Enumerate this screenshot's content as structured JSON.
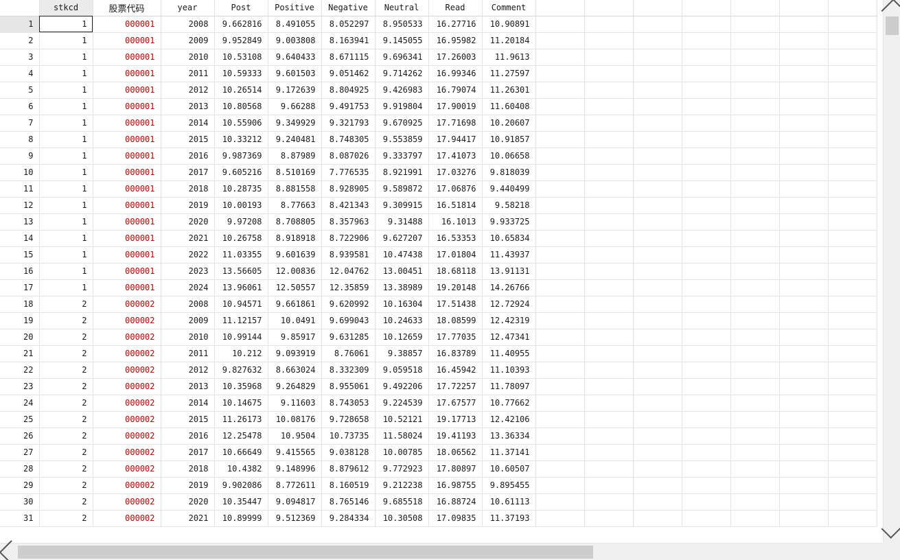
{
  "columns": [
    "stkcd",
    "股票代码",
    "year",
    "Post",
    "Positive",
    "Negative",
    "Neutral",
    "Read",
    "Comment"
  ],
  "rows": [
    [
      "1",
      "1",
      "000001",
      "2008",
      "9.662816",
      "8.491055",
      "8.052297",
      "8.950533",
      "16.27716",
      "10.90891"
    ],
    [
      "2",
      "1",
      "000001",
      "2009",
      "9.952849",
      "9.003808",
      "8.163941",
      "9.145055",
      "16.95982",
      "11.20184"
    ],
    [
      "3",
      "1",
      "000001",
      "2010",
      "10.53108",
      "9.640433",
      "8.671115",
      "9.696341",
      "17.26003",
      "11.9613"
    ],
    [
      "4",
      "1",
      "000001",
      "2011",
      "10.59333",
      "9.601503",
      "9.051462",
      "9.714262",
      "16.99346",
      "11.27597"
    ],
    [
      "5",
      "1",
      "000001",
      "2012",
      "10.26514",
      "9.172639",
      "8.804925",
      "9.426983",
      "16.79074",
      "11.26301"
    ],
    [
      "6",
      "1",
      "000001",
      "2013",
      "10.80568",
      "9.66288",
      "9.491753",
      "9.919804",
      "17.90019",
      "11.60408"
    ],
    [
      "7",
      "1",
      "000001",
      "2014",
      "10.55906",
      "9.349929",
      "9.321793",
      "9.670925",
      "17.71698",
      "10.20607"
    ],
    [
      "8",
      "1",
      "000001",
      "2015",
      "10.33212",
      "9.240481",
      "8.748305",
      "9.553859",
      "17.94417",
      "10.91857"
    ],
    [
      "9",
      "1",
      "000001",
      "2016",
      "9.987369",
      "8.87989",
      "8.087026",
      "9.333797",
      "17.41073",
      "10.06658"
    ],
    [
      "10",
      "1",
      "000001",
      "2017",
      "9.605216",
      "8.510169",
      "7.776535",
      "8.921991",
      "17.03276",
      "9.818039"
    ],
    [
      "11",
      "1",
      "000001",
      "2018",
      "10.28735",
      "8.881558",
      "8.928905",
      "9.589872",
      "17.06876",
      "9.440499"
    ],
    [
      "12",
      "1",
      "000001",
      "2019",
      "10.00193",
      "8.77663",
      "8.421343",
      "9.309915",
      "16.51814",
      "9.58218"
    ],
    [
      "13",
      "1",
      "000001",
      "2020",
      "9.97208",
      "8.708805",
      "8.357963",
      "9.31488",
      "16.1013",
      "9.933725"
    ],
    [
      "14",
      "1",
      "000001",
      "2021",
      "10.26758",
      "8.918918",
      "8.722906",
      "9.627207",
      "16.53353",
      "10.65834"
    ],
    [
      "15",
      "1",
      "000001",
      "2022",
      "11.03355",
      "9.601639",
      "8.939581",
      "10.47438",
      "17.01804",
      "11.43937"
    ],
    [
      "16",
      "1",
      "000001",
      "2023",
      "13.56605",
      "12.00836",
      "12.04762",
      "13.00451",
      "18.68118",
      "13.91131"
    ],
    [
      "17",
      "1",
      "000001",
      "2024",
      "13.96061",
      "12.50557",
      "12.35859",
      "13.38989",
      "19.20148",
      "14.26766"
    ],
    [
      "18",
      "2",
      "000002",
      "2008",
      "10.94571",
      "9.661861",
      "9.620992",
      "10.16304",
      "17.51438",
      "12.72924"
    ],
    [
      "19",
      "2",
      "000002",
      "2009",
      "11.12157",
      "10.0491",
      "9.699043",
      "10.24633",
      "18.08599",
      "12.42319"
    ],
    [
      "20",
      "2",
      "000002",
      "2010",
      "10.99144",
      "9.85917",
      "9.631285",
      "10.12659",
      "17.77035",
      "12.47341"
    ],
    [
      "21",
      "2",
      "000002",
      "2011",
      "10.212",
      "9.093919",
      "8.76061",
      "9.38857",
      "16.83789",
      "11.40955"
    ],
    [
      "22",
      "2",
      "000002",
      "2012",
      "9.827632",
      "8.663024",
      "8.332309",
      "9.059518",
      "16.45942",
      "11.10393"
    ],
    [
      "23",
      "2",
      "000002",
      "2013",
      "10.35968",
      "9.264829",
      "8.955061",
      "9.492206",
      "17.72257",
      "11.78097"
    ],
    [
      "24",
      "2",
      "000002",
      "2014",
      "10.14675",
      "9.11603",
      "8.743053",
      "9.224539",
      "17.67577",
      "10.77662"
    ],
    [
      "25",
      "2",
      "000002",
      "2015",
      "11.26173",
      "10.08176",
      "9.728658",
      "10.52121",
      "19.17713",
      "12.42106"
    ],
    [
      "26",
      "2",
      "000002",
      "2016",
      "12.25478",
      "10.9504",
      "10.73735",
      "11.58024",
      "19.41193",
      "13.36334"
    ],
    [
      "27",
      "2",
      "000002",
      "2017",
      "10.66649",
      "9.415565",
      "9.038128",
      "10.00785",
      "18.06562",
      "11.37141"
    ],
    [
      "28",
      "2",
      "000002",
      "2018",
      "10.4382",
      "9.148996",
      "8.879612",
      "9.772923",
      "17.80897",
      "10.60507"
    ],
    [
      "29",
      "2",
      "000002",
      "2019",
      "9.902086",
      "8.772611",
      "8.160519",
      "9.212238",
      "16.98755",
      "9.895455"
    ],
    [
      "30",
      "2",
      "000002",
      "2020",
      "10.35447",
      "9.094817",
      "8.765146",
      "9.685518",
      "16.88724",
      "10.61113"
    ],
    [
      "31",
      "2",
      "000002",
      "2021",
      "10.89999",
      "9.512369",
      "9.284334",
      "10.30508",
      "17.09835",
      "11.37193"
    ]
  ],
  "selected_cell": {
    "row": 0,
    "column": "stkcd"
  },
  "colors": {
    "string_text": "#c00000",
    "header_selected_bg": "#ebebeb",
    "row_selected_bg": "#e6e6e6",
    "scrollbar_bg": "#f0f0f0",
    "scrollbar_thumb": "#cdcdcd"
  },
  "icons": {
    "scroll_left": "chevron-left-icon",
    "scroll_right": "chevron-right-icon",
    "scroll_up": "chevron-up-icon",
    "scroll_down": "chevron-down-icon"
  }
}
